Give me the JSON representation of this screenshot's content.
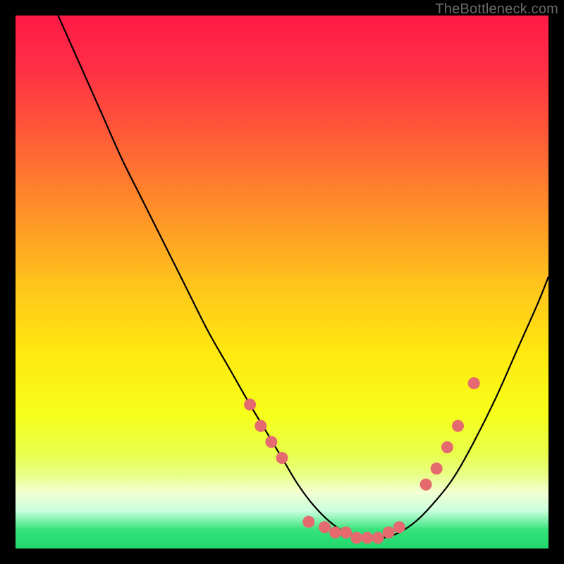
{
  "watermark": "TheBottleneck.com",
  "gradient_stops": [
    {
      "offset": 0.0,
      "color": "#ff1a47"
    },
    {
      "offset": 0.1,
      "color": "#ff2f45"
    },
    {
      "offset": 0.22,
      "color": "#ff5a38"
    },
    {
      "offset": 0.35,
      "color": "#ff8a2a"
    },
    {
      "offset": 0.5,
      "color": "#ffc21c"
    },
    {
      "offset": 0.63,
      "color": "#ffe80f"
    },
    {
      "offset": 0.75,
      "color": "#f6ff1a"
    },
    {
      "offset": 0.82,
      "color": "#e8ff4a"
    },
    {
      "offset": 0.86,
      "color": "#e8ff82"
    },
    {
      "offset": 0.895,
      "color": "#f4ffd4"
    },
    {
      "offset": 0.93,
      "color": "#c8ffdc"
    },
    {
      "offset": 0.965,
      "color": "#35e27a"
    },
    {
      "offset": 1.0,
      "color": "#22d86c"
    }
  ],
  "chart_data": {
    "type": "line",
    "title": "",
    "xlabel": "",
    "ylabel": "",
    "xlim": [
      0,
      100
    ],
    "ylim": [
      0,
      100
    ],
    "grid": false,
    "legend": false,
    "series": [
      {
        "name": "bottleneck-curve",
        "x": [
          8,
          12,
          16,
          20,
          24,
          28,
          32,
          36,
          40,
          44,
          47,
          50,
          53,
          56,
          59,
          62,
          65.5,
          69,
          72,
          75,
          78,
          82,
          86,
          90,
          94,
          98,
          100
        ],
        "y": [
          100,
          91,
          82,
          73,
          65,
          57,
          49,
          41,
          34,
          27,
          22,
          17,
          12,
          8,
          5,
          3,
          2,
          2,
          3,
          5,
          8,
          13,
          20,
          28,
          37,
          46,
          51
        ]
      }
    ],
    "markers": {
      "name": "highlight-dots",
      "color": "#e46a6f",
      "radius_px": 8.5,
      "points": [
        {
          "x": 44,
          "y": 27
        },
        {
          "x": 46,
          "y": 23
        },
        {
          "x": 48,
          "y": 20
        },
        {
          "x": 50,
          "y": 17
        },
        {
          "x": 55,
          "y": 5
        },
        {
          "x": 58,
          "y": 4
        },
        {
          "x": 60,
          "y": 3
        },
        {
          "x": 62,
          "y": 3
        },
        {
          "x": 64,
          "y": 2
        },
        {
          "x": 66,
          "y": 2
        },
        {
          "x": 68,
          "y": 2
        },
        {
          "x": 70,
          "y": 3
        },
        {
          "x": 72,
          "y": 4
        },
        {
          "x": 77,
          "y": 12
        },
        {
          "x": 79,
          "y": 15
        },
        {
          "x": 81,
          "y": 19
        },
        {
          "x": 83,
          "y": 23
        },
        {
          "x": 86,
          "y": 31
        }
      ]
    }
  }
}
